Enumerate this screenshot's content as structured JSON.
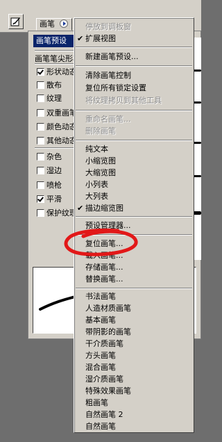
{
  "palette": {
    "tab_label": "画笔",
    "preset_header": "画笔预设",
    "tip_label": "画笔笔尖形状",
    "options": [
      {
        "label": "形状动态",
        "checked": true
      },
      {
        "label": "散布",
        "checked": false
      },
      {
        "label": "纹理",
        "checked": false
      },
      {
        "label": "双重画笔",
        "checked": false
      },
      {
        "label": "颜色动态",
        "checked": false
      },
      {
        "label": "其他动态",
        "checked": false
      },
      {
        "label": "杂色",
        "checked": false
      },
      {
        "label": "湿边",
        "checked": false
      },
      {
        "label": "喷枪",
        "checked": false
      },
      {
        "label": "平滑",
        "checked": true
      },
      {
        "label": "保护纹理",
        "checked": false
      }
    ]
  },
  "menu": {
    "dock_to_well": "停放到调板窗",
    "expanded_view": "扩展视图",
    "new_preset": "新建画笔预设...",
    "clear_brush_controls": "清除画笔控制",
    "reset_all_locked": "复位所有锁定设置",
    "copy_texture": "将纹理拷贝到其他工具",
    "rename_brush": "重命名画笔...",
    "delete_brush": "删除画笔",
    "text_only": "纯文本",
    "small_thumb": "小缩览图",
    "large_thumb": "大缩览图",
    "small_list": "小列表",
    "large_list": "大列表",
    "stroke_thumb": "描边缩览图",
    "preset_manager": "预设管理器...",
    "reset_brushes": "复位画笔...",
    "load_brushes": "载入画笔...",
    "save_brushes": "存储画笔...",
    "replace_brushes": "替换画笔...",
    "libraries": [
      "书法画笔",
      "人造材质画笔",
      "基本画笔",
      "带阴影的画笔",
      "干介质画笔",
      "方头画笔",
      "混合画笔",
      "湿介质画笔",
      "特殊效果画笔",
      "粗画笔",
      "自然画笔 2",
      "自然画笔"
    ]
  }
}
